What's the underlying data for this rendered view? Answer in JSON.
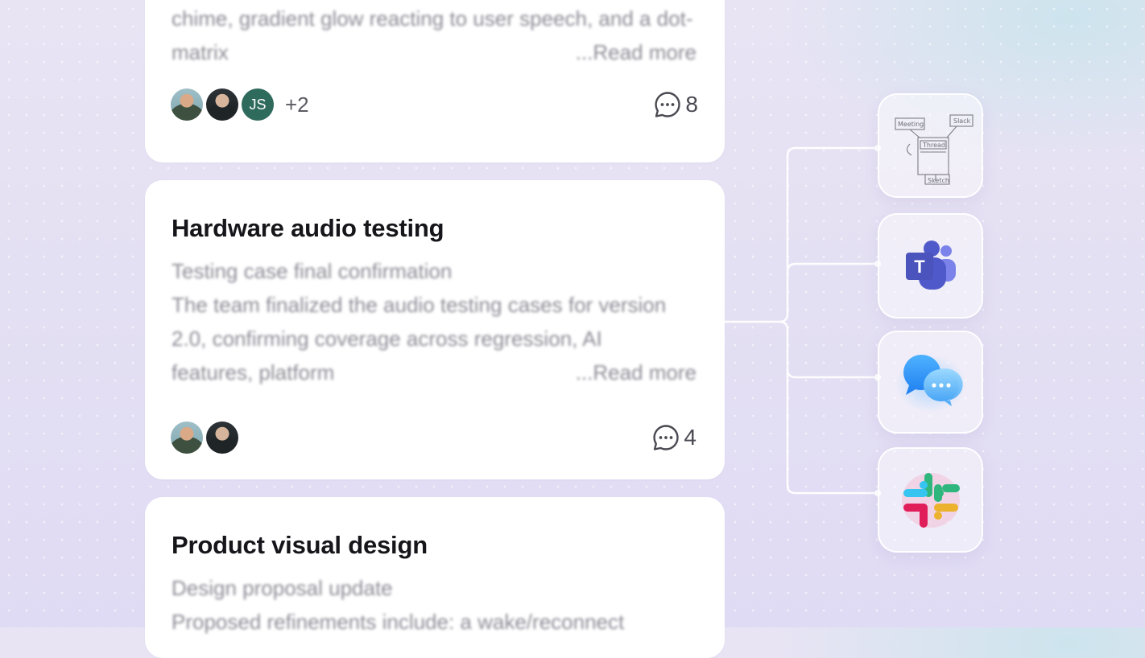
{
  "cards": [
    {
      "id": "top",
      "body": "chime, gradient glow reacting to user speech, and a dot-matrix",
      "read_more": "...Read more",
      "avatars": [
        {
          "type": "photo",
          "name": "avatar-photo-1"
        },
        {
          "type": "photo",
          "name": "avatar-photo-2"
        },
        {
          "type": "initials",
          "initials": "JS",
          "color": "#2f6b5d"
        }
      ],
      "extra_participants": "+2",
      "comment_count": "8"
    },
    {
      "id": "mid",
      "title": "Hardware audio testing",
      "subtitle": "Testing case final confirmation",
      "body": "The team finalized the audio testing cases for version 2.0, confirming coverage across regression, AI features, platform",
      "read_more": "...Read more",
      "comment_count": "4"
    },
    {
      "id": "bot",
      "title": "Product visual design",
      "subtitle": "Design proposal update",
      "body": "Proposed refinements include: a wake/reconnect"
    }
  ],
  "integrations": [
    {
      "name": "sketch-diagram",
      "icon": "sketch-diagram-icon",
      "labels": [
        "Meeting",
        "Slack",
        "Thread",
        "Sketch"
      ]
    },
    {
      "name": "microsoft-teams",
      "icon": "microsoft-teams-icon",
      "letter": "T"
    },
    {
      "name": "messages",
      "icon": "chat-bubbles-icon"
    },
    {
      "name": "slack",
      "icon": "slack-icon"
    }
  ],
  "colors": {
    "teams_purple": "#5059c9",
    "messages_blue": "#2f8cf0",
    "slack_red": "#e01e5a",
    "slack_green": "#2eb67d",
    "slack_yellow": "#ecb22e",
    "slack_blue": "#36c5f0"
  }
}
